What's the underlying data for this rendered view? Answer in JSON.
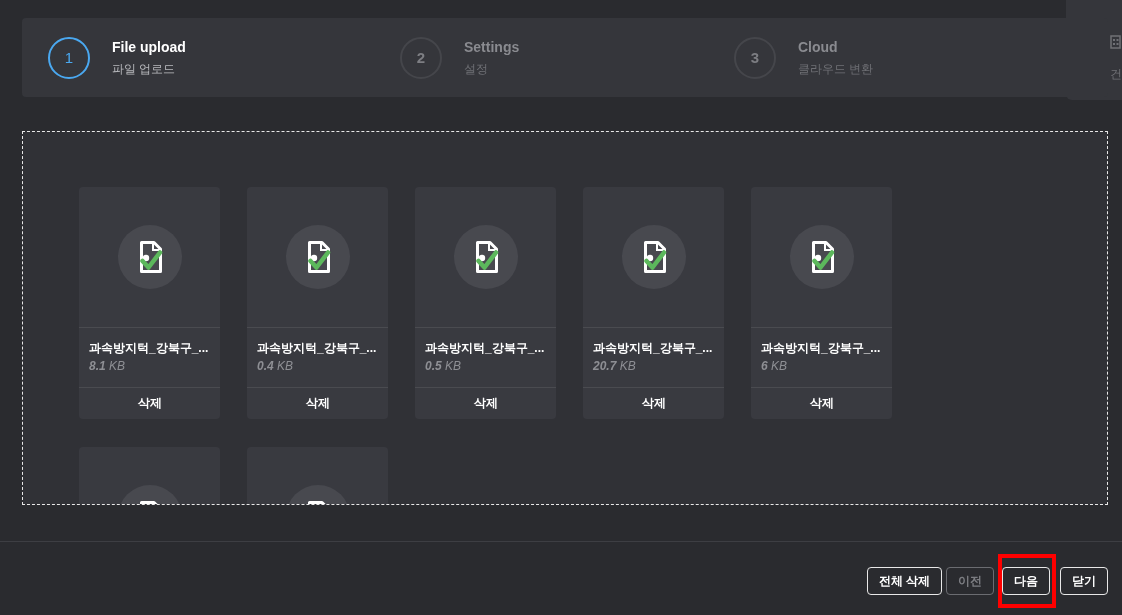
{
  "steps": [
    {
      "number": "1",
      "title": "File upload",
      "subtitle": "파일 업로드",
      "selected": true
    },
    {
      "number": "2",
      "title": "Settings",
      "subtitle": "설정",
      "selected": false
    },
    {
      "number": "3",
      "title": "Cloud",
      "subtitle": "클라우드 변환",
      "selected": false
    }
  ],
  "background_panel": {
    "label": "건"
  },
  "files": [
    {
      "name": "과속방지턱_강북구_...",
      "size": "**8.1** KB",
      "delete": "삭제",
      "uploaded": true,
      "clipped": false
    },
    {
      "name": "과속방지턱_강북구_...",
      "size": "**0.4** KB",
      "delete": "삭제",
      "uploaded": true,
      "clipped": false
    },
    {
      "name": "과속방지턱_강북구_...",
      "size": "**0.5** KB",
      "delete": "삭제",
      "uploaded": true,
      "clipped": false
    },
    {
      "name": "과속방지턱_강북구_...",
      "size": "**20.7** KB",
      "delete": "삭제",
      "uploaded": true,
      "clipped": false
    },
    {
      "name": "과속방지턱_강북구_...",
      "size": "**6** KB",
      "delete": "삭제",
      "uploaded": true,
      "clipped": false
    },
    {
      "clipped": true
    },
    {
      "clipped": true
    }
  ],
  "buttons": [
    {
      "label": "전체 삭제",
      "disabled": false,
      "highlighted": false
    },
    {
      "label": "이전",
      "disabled": true,
      "highlighted": false
    },
    {
      "label": "다음",
      "disabled": false,
      "highlighted": true
    },
    {
      "label": "닫기",
      "disabled": false,
      "highlighted": false
    }
  ]
}
